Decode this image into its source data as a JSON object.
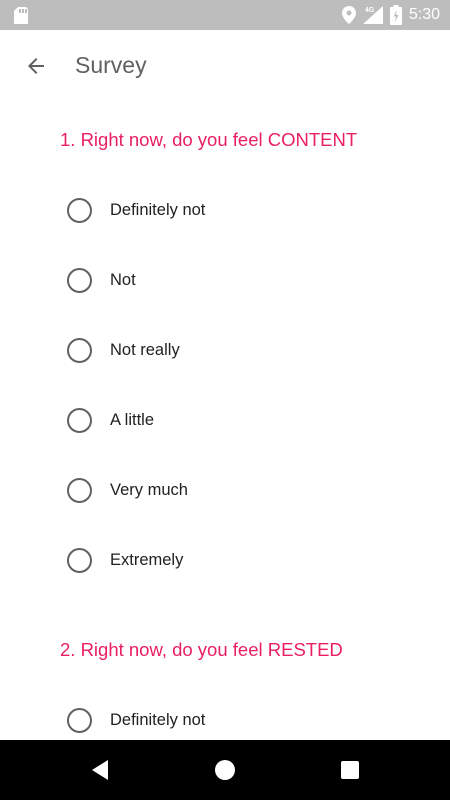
{
  "status_bar": {
    "time": "5:30",
    "network": "4G",
    "icons": [
      "sd-card-icon",
      "location-icon",
      "signal-icon",
      "battery-icon"
    ]
  },
  "app_bar": {
    "title": "Survey",
    "back_icon": "arrow-back-icon"
  },
  "accent_color": "#e91e63",
  "questions": [
    {
      "title": "1. Right now, do you feel CONTENT",
      "options": [
        {
          "label": "Definitely not",
          "selected": false
        },
        {
          "label": "Not",
          "selected": false
        },
        {
          "label": "Not really",
          "selected": false
        },
        {
          "label": "A little",
          "selected": false
        },
        {
          "label": "Very much",
          "selected": false
        },
        {
          "label": "Extremely",
          "selected": false
        }
      ]
    },
    {
      "title": "2. Right now, do you feel RESTED",
      "options": [
        {
          "label": "Definitely not",
          "selected": false
        }
      ]
    }
  ],
  "nav_bar": {
    "icons": [
      "nav-back-icon",
      "nav-home-icon",
      "nav-recents-icon"
    ]
  }
}
